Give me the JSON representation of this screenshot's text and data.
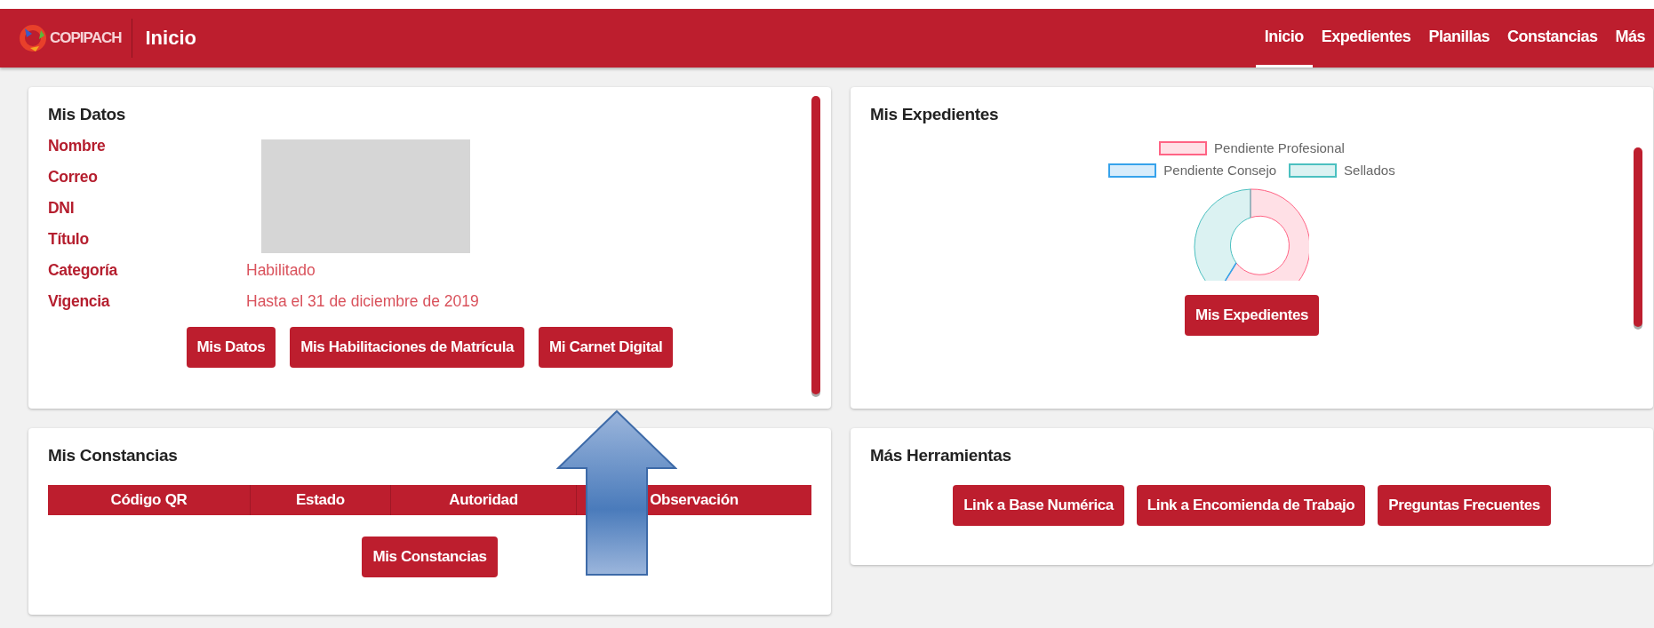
{
  "header": {
    "logo_text": "COPIPACH",
    "title": "Inicio"
  },
  "nav": [
    {
      "label": "Inicio",
      "selected": true
    },
    {
      "label": "Expedientes",
      "selected": false
    },
    {
      "label": "Planillas",
      "selected": false
    },
    {
      "label": "Constancias",
      "selected": false
    },
    {
      "label": "Más",
      "selected": false
    }
  ],
  "mis_datos": {
    "title": "Mis Datos",
    "fields": [
      {
        "label": "Nombre"
      },
      {
        "label": "Correo"
      },
      {
        "label": "DNI"
      },
      {
        "label": "Título"
      },
      {
        "label": "Categoría",
        "value": "Habilitado"
      },
      {
        "label": "Vigencia",
        "value": "Hasta el 31 de diciembre de 2019"
      }
    ],
    "buttons": [
      "Mis Datos",
      "Mis Habilitaciones de Matrícula",
      "Mi Carnet Digital"
    ]
  },
  "mis_expedientes": {
    "title": "Mis Expedientes",
    "legend": [
      {
        "label": "Pendiente Profesional",
        "color": "#ff6384"
      },
      {
        "label": "Pendiente Consejo",
        "color": "#36a2eb"
      },
      {
        "label": "Sellados",
        "color": "#4bc0c0"
      }
    ],
    "button": "Mis Expedientes"
  },
  "mis_constancias": {
    "title": "Mis Constancias",
    "columns": [
      "Código QR",
      "Estado",
      "Autoridad",
      "Observación"
    ],
    "button": "Mis Constancias"
  },
  "mas_herramientas": {
    "title": "Más Herramientas",
    "buttons": [
      "Link a Base Numérica",
      "Link a Encomienda de Trabajo",
      "Preguntas Frecuentes"
    ]
  }
}
